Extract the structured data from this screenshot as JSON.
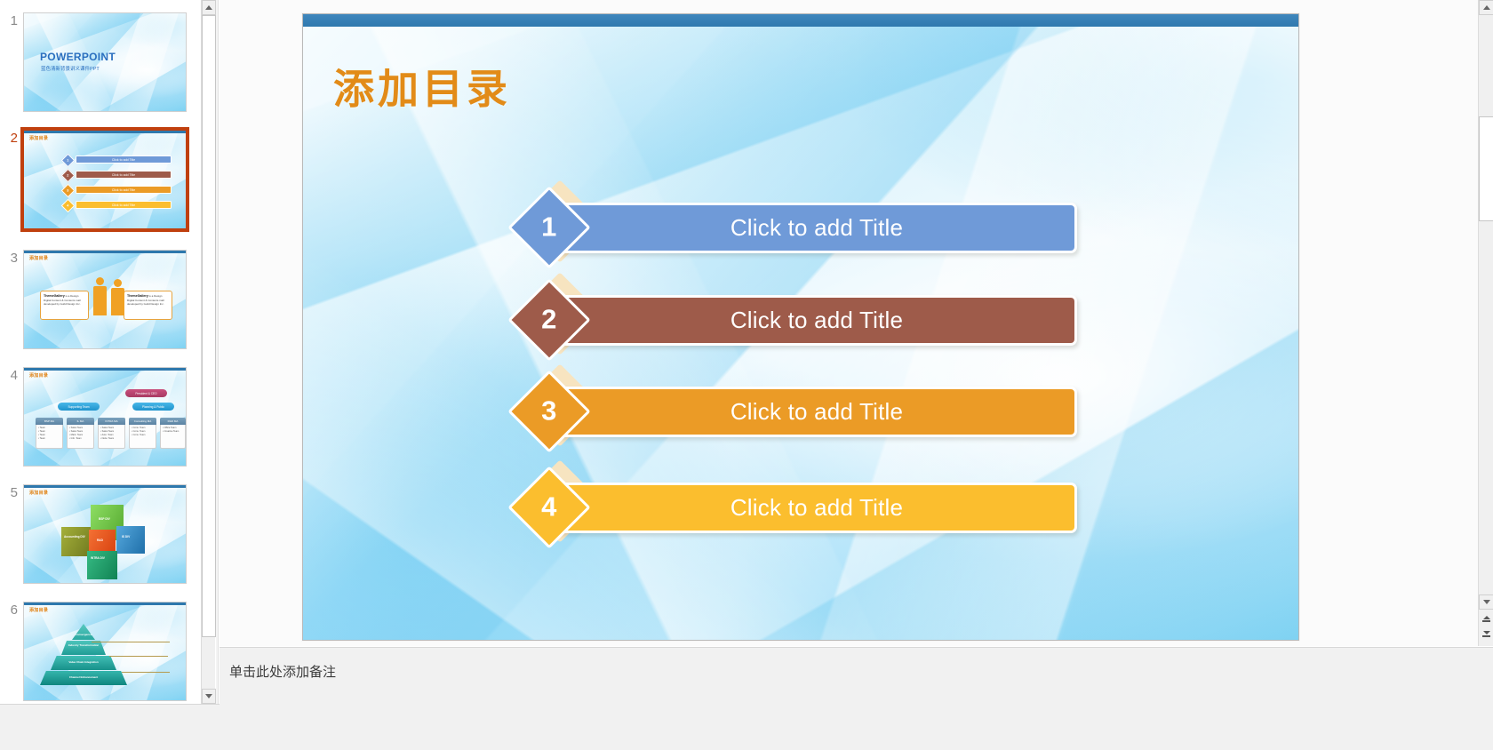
{
  "app": {
    "name": "PowerPoint",
    "selected_slide": 2
  },
  "colors": {
    "accent_orange": "#e28b18",
    "selection_red": "#c0400e",
    "topbar_blue": "#2f79ae",
    "bar1_blue": "#6f9ad8",
    "bar2_brown": "#9e5b4a",
    "bar3_orange": "#eb9b26",
    "bar4_yellow": "#fbbe2e",
    "diamond_shadow": "#f7e4c0"
  },
  "thumbnails": [
    {
      "number": "1",
      "selected": false,
      "title": "POWERPOINT",
      "subtitle": "蓝色清新背景讲义课件PPT"
    },
    {
      "number": "2",
      "selected": true,
      "title": "添加目录",
      "rows": [
        {
          "num": "1",
          "label": "Click to add Title",
          "color": "#6f9ad8"
        },
        {
          "num": "2",
          "label": "Click to add Title",
          "color": "#9e5b4a"
        },
        {
          "num": "3",
          "label": "Click to add Title",
          "color": "#eb9b26"
        },
        {
          "num": "4",
          "label": "Click to add Title",
          "color": "#fbbe2e"
        }
      ]
    },
    {
      "number": "3",
      "selected": false,
      "title": "添加目录",
      "cards": [
        {
          "heading": "ThemeGallery",
          "body": "is a Design Digital Content & Contents mall developed by Guild Design Inc."
        },
        {
          "heading": "ThemeGallery",
          "body": "is a Design Digital Content & Contents mall developed by Guild Design Inc."
        }
      ]
    },
    {
      "number": "4",
      "selected": false,
      "title": "添加目录",
      "org": {
        "top": "President & CEO",
        "mid": [
          "Supporting Team",
          "Planning & Public"
        ],
        "boxes": [
          {
            "head": "BSP MA",
            "items": [
              "Team",
              "Team",
              "Team",
              "Team"
            ]
          },
          {
            "head": "IL MA",
            "items": [
              "Sales Team",
              "Sales Team",
              "Marketing Team",
              "Information Team"
            ]
          },
          {
            "head": "INTRA MA",
            "items": [
              "Sales Team",
              "Sales Team",
              "Automation Team",
              "Network Team"
            ]
          },
          {
            "head": "Consulting MA",
            "items": [
              "Consulting Team",
              "Consulting Team",
              "Consulting Team"
            ]
          },
          {
            "head": "R&D MA",
            "items": [
              "Office Team",
              "Creative Team"
            ]
          }
        ]
      }
    },
    {
      "number": "5",
      "selected": false,
      "title": "添加目录",
      "cubes": [
        {
          "label": "BSP DIV",
          "color": "#6cc04a"
        },
        {
          "label": "Accounting DIV",
          "color": "#8a9a2b"
        },
        {
          "label": "R&D",
          "color": "#e8541e"
        },
        {
          "label": "IS DIV",
          "color": "#2f86c4"
        },
        {
          "label": "INTRA DIV",
          "color": "#1f9c6a"
        }
      ]
    },
    {
      "number": "6",
      "selected": false,
      "title": "添加目录",
      "pyramid": [
        {
          "label": "Convergence"
        },
        {
          "label": "Industry Transformation"
        },
        {
          "label": "Value Chain Integration"
        },
        {
          "label": "Channel Enhancement"
        }
      ]
    }
  ],
  "slide": {
    "title": "添加目录",
    "rows": [
      {
        "num": "1",
        "label": "Click to add Title",
        "color": "#6f9ad8"
      },
      {
        "num": "2",
        "label": "Click to add Title",
        "color": "#9e5b4a"
      },
      {
        "num": "3",
        "label": "Click to add Title",
        "color": "#eb9b26"
      },
      {
        "num": "4",
        "label": "Click to add Title",
        "color": "#fbbe2e"
      }
    ]
  },
  "notes": {
    "placeholder": "单击此处添加备注"
  },
  "icons": {
    "scroll_up": "triangle-up-icon",
    "scroll_down": "triangle-down-icon",
    "previous_slide": "double-arrow-up-icon",
    "next_slide": "double-arrow-down-icon"
  }
}
